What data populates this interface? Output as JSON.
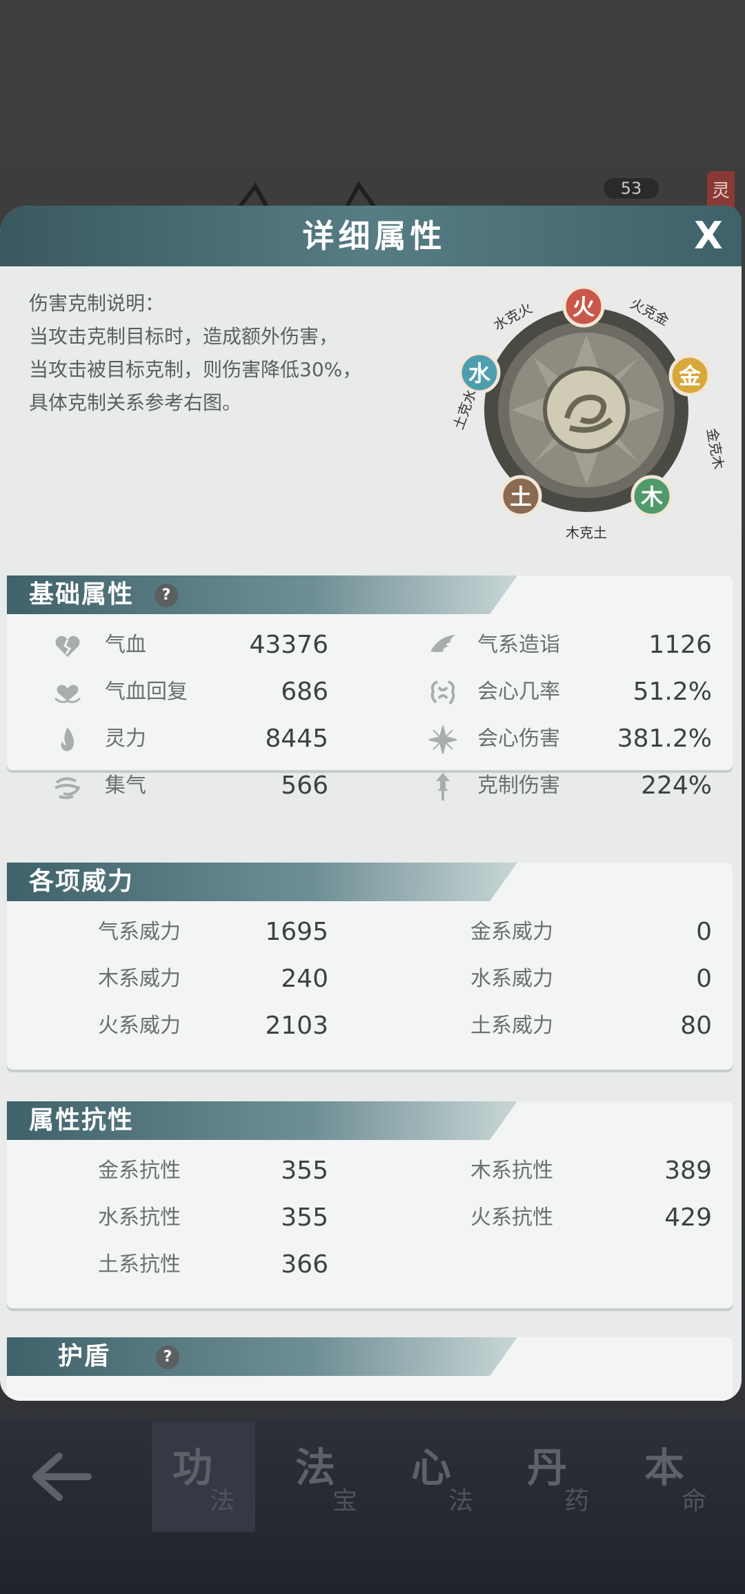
{
  "background": {
    "badge": "53",
    "tag": "灵"
  },
  "panel": {
    "title": "详细属性",
    "close_label": "X"
  },
  "description": {
    "lines": [
      "伤害克制说明：",
      "当攻击克制目标时，造成额外伤害，",
      "当攻击被目标克制，则伤害降低30%，",
      "具体克制关系参考右图。"
    ]
  },
  "wheel": {
    "elements": {
      "fire": "火",
      "metal": "金",
      "wood": "木",
      "earth": "土",
      "water": "水"
    },
    "relations": {
      "fire_metal": "火克金",
      "metal_wood": "金克木",
      "wood_earth": "木克土",
      "earth_water": "土克水",
      "water_fire": "水克火"
    },
    "colors": {
      "fire": "#c9584a",
      "metal": "#d8a93a",
      "wood": "#4f9a6a",
      "earth": "#8a6a50",
      "water": "#4f9eb0"
    }
  },
  "basic": {
    "title": "基础属性",
    "help": "?",
    "left": [
      {
        "icon": "broken-heart-icon",
        "label": "气血",
        "value": "43376"
      },
      {
        "icon": "heart-regen-icon",
        "label": "气血回复",
        "value": "686"
      },
      {
        "icon": "spirit-flame-icon",
        "label": "灵力",
        "value": "8445"
      },
      {
        "icon": "swirl-qi-icon",
        "label": "集气",
        "value": "566"
      }
    ],
    "right": [
      {
        "icon": "qi-wing-icon",
        "label": "气系造诣",
        "value": "1126"
      },
      {
        "icon": "crit-rate-icon",
        "label": "会心几率",
        "value": "51.2%"
      },
      {
        "icon": "crit-damage-icon",
        "label": "会心伤害",
        "value": "381.2%"
      },
      {
        "icon": "restraint-icon",
        "label": "克制伤害",
        "value": "224%"
      }
    ]
  },
  "power": {
    "title": "各项威力",
    "left": [
      {
        "label": "气系威力",
        "value": "1695"
      },
      {
        "label": "木系威力",
        "value": "240"
      },
      {
        "label": "火系威力",
        "value": "2103"
      }
    ],
    "right": [
      {
        "label": "金系威力",
        "value": "0"
      },
      {
        "label": "水系威力",
        "value": "0"
      },
      {
        "label": "土系威力",
        "value": "80"
      }
    ]
  },
  "resist": {
    "title": "属性抗性",
    "left": [
      {
        "label": "金系抗性",
        "value": "355"
      },
      {
        "label": "水系抗性",
        "value": "355"
      },
      {
        "label": "土系抗性",
        "value": "366"
      }
    ],
    "right": [
      {
        "label": "木系抗性",
        "value": "389"
      },
      {
        "label": "火系抗性",
        "value": "429"
      }
    ]
  },
  "shield": {
    "title": "护盾",
    "help": "?"
  },
  "tabs": [
    {
      "big": "功",
      "small": "法"
    },
    {
      "big": "法",
      "small": "宝"
    },
    {
      "big": "心",
      "small": "法"
    },
    {
      "big": "丹",
      "small": "药"
    },
    {
      "big": "本",
      "small": "命"
    }
  ]
}
